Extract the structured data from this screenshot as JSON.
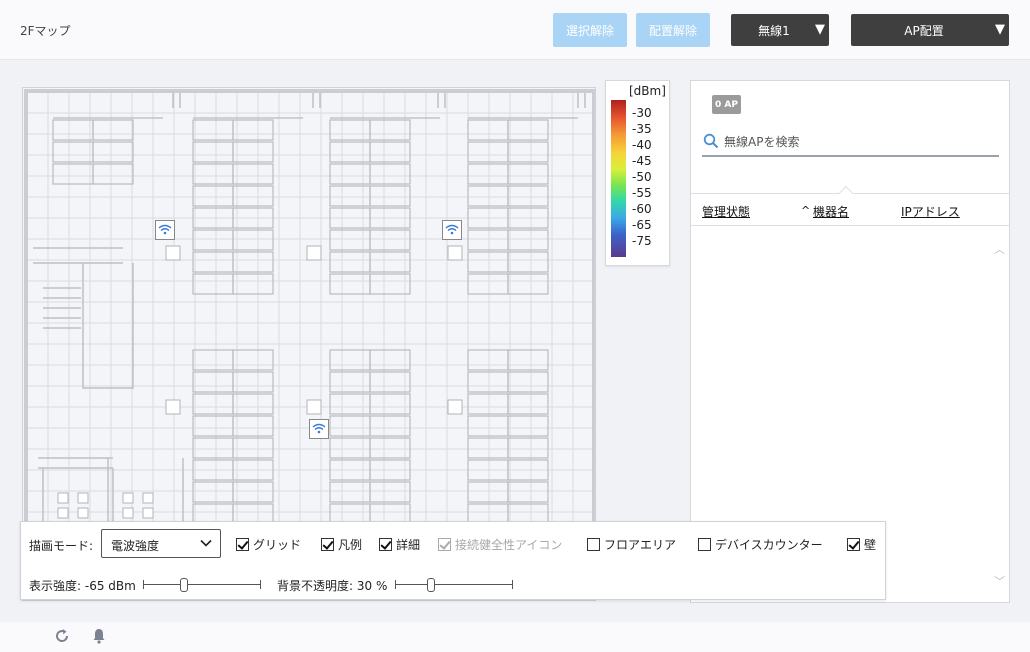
{
  "header": {
    "title": "2Fマップ",
    "deselect_label": "選択解除",
    "unplace_label": "配置解除",
    "radio_dropdown": "無線1",
    "mode_dropdown": "AP配置"
  },
  "legend": {
    "unit": "[dBm]",
    "ticks": [
      "-30",
      "-35",
      "-40",
      "-45",
      "-50",
      "-55",
      "-60",
      "-65",
      "-75"
    ]
  },
  "ap_panel": {
    "badge": "0 AP",
    "search_placeholder": "無線APを検索",
    "columns": [
      "管理状態",
      "機器名",
      "IPアドレス"
    ],
    "sort_indicator": "^"
  },
  "toolbar": {
    "draw_mode_label": "描画モード:",
    "draw_mode_value": "電波強度",
    "checkboxes": [
      {
        "label": "グリッド",
        "checked": true,
        "disabled": false
      },
      {
        "label": "凡例",
        "checked": true,
        "disabled": false
      },
      {
        "label": "詳細",
        "checked": true,
        "disabled": false
      },
      {
        "label": "接続健全性アイコン",
        "checked": true,
        "disabled": true
      },
      {
        "label": "フロアエリア",
        "checked": false,
        "disabled": false
      },
      {
        "label": "デバイスカウンター",
        "checked": false,
        "disabled": false
      },
      {
        "label": "壁",
        "checked": true,
        "disabled": false
      }
    ],
    "strength_label": "表示強度: -65 dBm",
    "strength_value": -65,
    "opacity_label": "背景不透明度: 30 %",
    "opacity_value": 30
  },
  "icons": {
    "ap_marker": "wifi-icon",
    "search": "search-icon",
    "refresh": "refresh-icon",
    "notification": "bell-icon",
    "dropdown": "chevron-down-icon"
  },
  "colors": {
    "light_button": "#a9d4f5",
    "dark_dropdown": "#3f3f3f",
    "badge": "#9b9b9b"
  }
}
